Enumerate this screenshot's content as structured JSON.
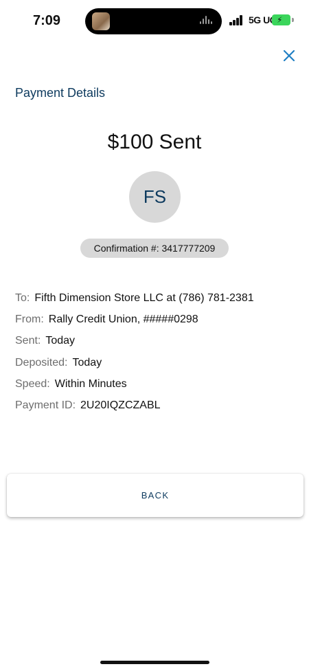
{
  "status_bar": {
    "time": "7:09",
    "network": "5G UC",
    "battery_state": "charging",
    "battery_color": "#3bd55b"
  },
  "header": {
    "close_icon": "close-icon",
    "title": "Payment Details"
  },
  "summary": {
    "amount_text": "$100 Sent",
    "avatar_initials": "FS",
    "confirmation": "Confirmation #: 3417777209"
  },
  "details": [
    {
      "label": "To:",
      "value": "Fifth Dimension Store LLC at (786) 781-2381"
    },
    {
      "label": "From:",
      "value": "Rally Credit Union, #####0298"
    },
    {
      "label": "Sent:",
      "value": "Today"
    },
    {
      "label": "Deposited:",
      "value": "Today"
    },
    {
      "label": "Speed:",
      "value": "Within Minutes"
    },
    {
      "label": "Payment ID:",
      "value": "2U20IQZCZABL"
    }
  ],
  "actions": {
    "back_label": "BACK"
  },
  "colors": {
    "accent": "#0d3a5e",
    "close_icon": "#1f7fc4",
    "badge_bg": "#d8d8d8"
  }
}
